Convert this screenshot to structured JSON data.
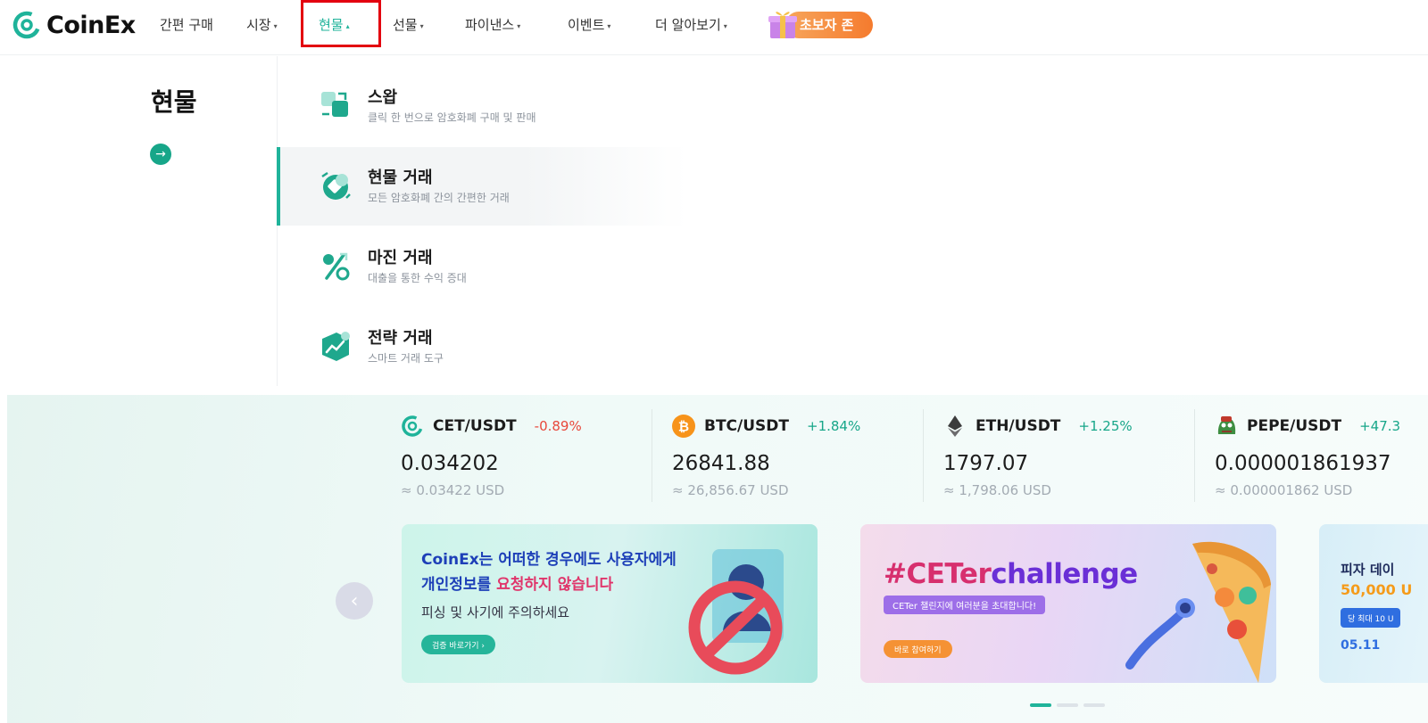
{
  "brand": {
    "name": "CoinEx",
    "accent": "#1fb39a"
  },
  "nav": {
    "items": [
      {
        "label": "간편 구매",
        "has_caret": false
      },
      {
        "label": "시장",
        "has_caret": true
      },
      {
        "label": "현물",
        "has_caret": true,
        "active": true
      },
      {
        "label": "선물",
        "has_caret": true
      },
      {
        "label": "파이낸스",
        "has_caret": true
      },
      {
        "label": "이벤트",
        "has_caret": true
      },
      {
        "label": "더 알아보기",
        "has_caret": true
      }
    ],
    "promo_label": "초보자 존",
    "caret_down": "▾",
    "caret_up": "▴"
  },
  "dropdown": {
    "title": "현물",
    "arrow": "→",
    "items": [
      {
        "label": "스왑",
        "desc": "클릭 한 번으로 암호화폐 구매 및 판매",
        "icon": "swap-icon"
      },
      {
        "label": "현물 거래",
        "desc": "모든 암호화폐 간의 간편한 거래",
        "icon": "spot-trading-icon",
        "selected": true
      },
      {
        "label": "마진 거래",
        "desc": "대출을 통한 수익 증대",
        "icon": "margin-percent-icon"
      },
      {
        "label": "전략 거래",
        "desc": "스마트 거래 도구",
        "icon": "strategy-chart-icon"
      }
    ]
  },
  "tickers": [
    {
      "pair": "CET/USDT",
      "change": "-0.89%",
      "direction": "down",
      "price": "0.034202",
      "usd": "≈ 0.03422 USD",
      "icon": "cet-coin-icon"
    },
    {
      "pair": "BTC/USDT",
      "change": "+1.84%",
      "direction": "up",
      "price": "26841.88",
      "usd": "≈ 26,856.67 USD",
      "icon": "btc-coin-icon"
    },
    {
      "pair": "ETH/USDT",
      "change": "+1.25%",
      "direction": "up",
      "price": "1797.07",
      "usd": "≈ 1,798.06 USD",
      "icon": "eth-coin-icon"
    },
    {
      "pair": "PEPE/USDT",
      "change": "+47.3",
      "direction": "up",
      "price": "0.000001861937",
      "usd": "≈ 0.000001862 USD",
      "icon": "pepe-coin-icon"
    }
  ],
  "banners": {
    "prev": "‹",
    "b1": {
      "title_a": "CoinEx는 어떠한 경우에도 사용자에게 개인정보를 ",
      "title_b": "요청하지 않습니다",
      "subtitle": "피싱 및 사기에 주의하세요",
      "button": "검증 바로가기  ›"
    },
    "b2": {
      "title_a": "#CETer",
      "title_b": "challenge",
      "subtitle": "CETer 챌린지에 여러분을 초대합니다!",
      "button": "바로 참여하기"
    },
    "b3": {
      "line1": "피자 데이",
      "line2": "50,000 U",
      "chip": "당 최대 10 U",
      "date": "05.11"
    }
  }
}
